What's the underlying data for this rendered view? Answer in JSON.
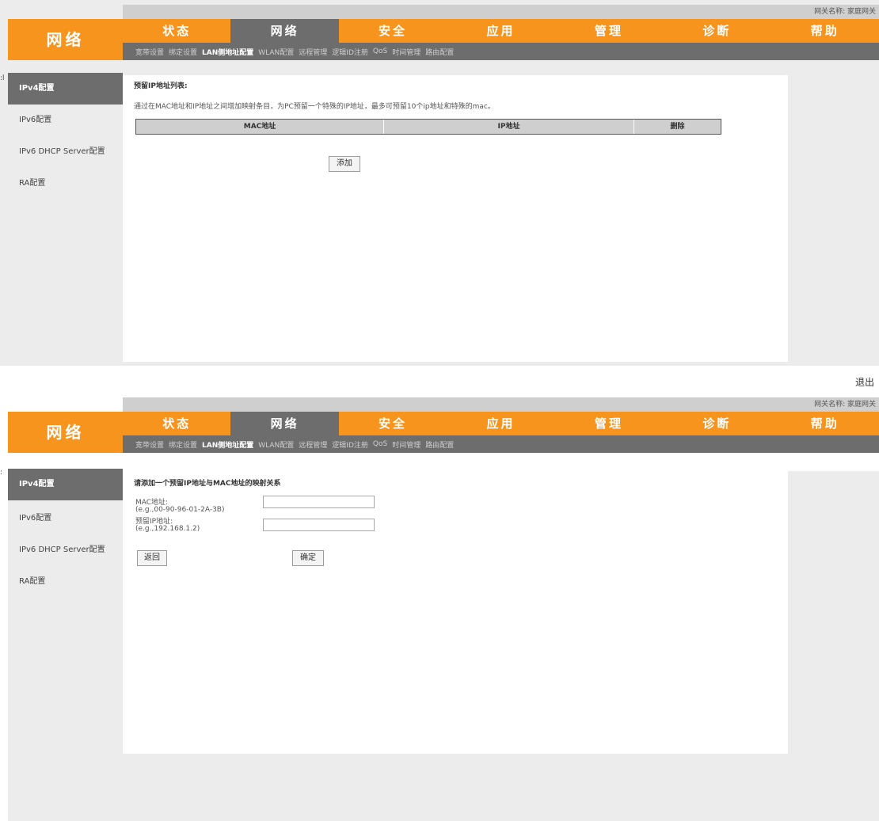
{
  "header": {
    "logo_text": "网络",
    "gateway_name": "网关名称: 家庭网关",
    "logout": "退出",
    "tabs": [
      "状态",
      "网络",
      "安全",
      "应用",
      "管理",
      "诊断",
      "帮助"
    ],
    "active_tab": "网络",
    "subtabs": [
      "宽带设置",
      "绑定设置",
      "LAN侧地址配置",
      "WLAN配置",
      "远程管理",
      "逻辑ID注册",
      "QoS",
      "时间管理",
      "路由配置"
    ],
    "active_subtab": "LAN侧地址配置"
  },
  "sidebar": {
    "items": [
      "IPv4配置",
      "IPv6配置",
      "IPv6 DHCP Server配置",
      "RA配置"
    ],
    "active": "IPv4配置"
  },
  "list_page": {
    "title": "预留IP地址列表:",
    "description": "通过在MAC地址和IP地址之间增加映射条目，为PC预留一个特殊的IP地址，最多可预留10个ip地址和特殊的mac。",
    "columns": [
      "MAC地址",
      "IP地址",
      "删除"
    ],
    "add_button": "添加"
  },
  "add_page": {
    "title": "请添加一个预留IP地址与MAC地址的映射关系",
    "mac_label": "MAC地址:",
    "mac_hint": "(e.g.,00-90-96-01-2A-3B)",
    "mac_value": "",
    "ip_label": "预留IP地址:",
    "ip_hint": "(e.g.,192.168.1.2)",
    "ip_value": "",
    "back_button": "返回",
    "ok_button": "确定"
  }
}
